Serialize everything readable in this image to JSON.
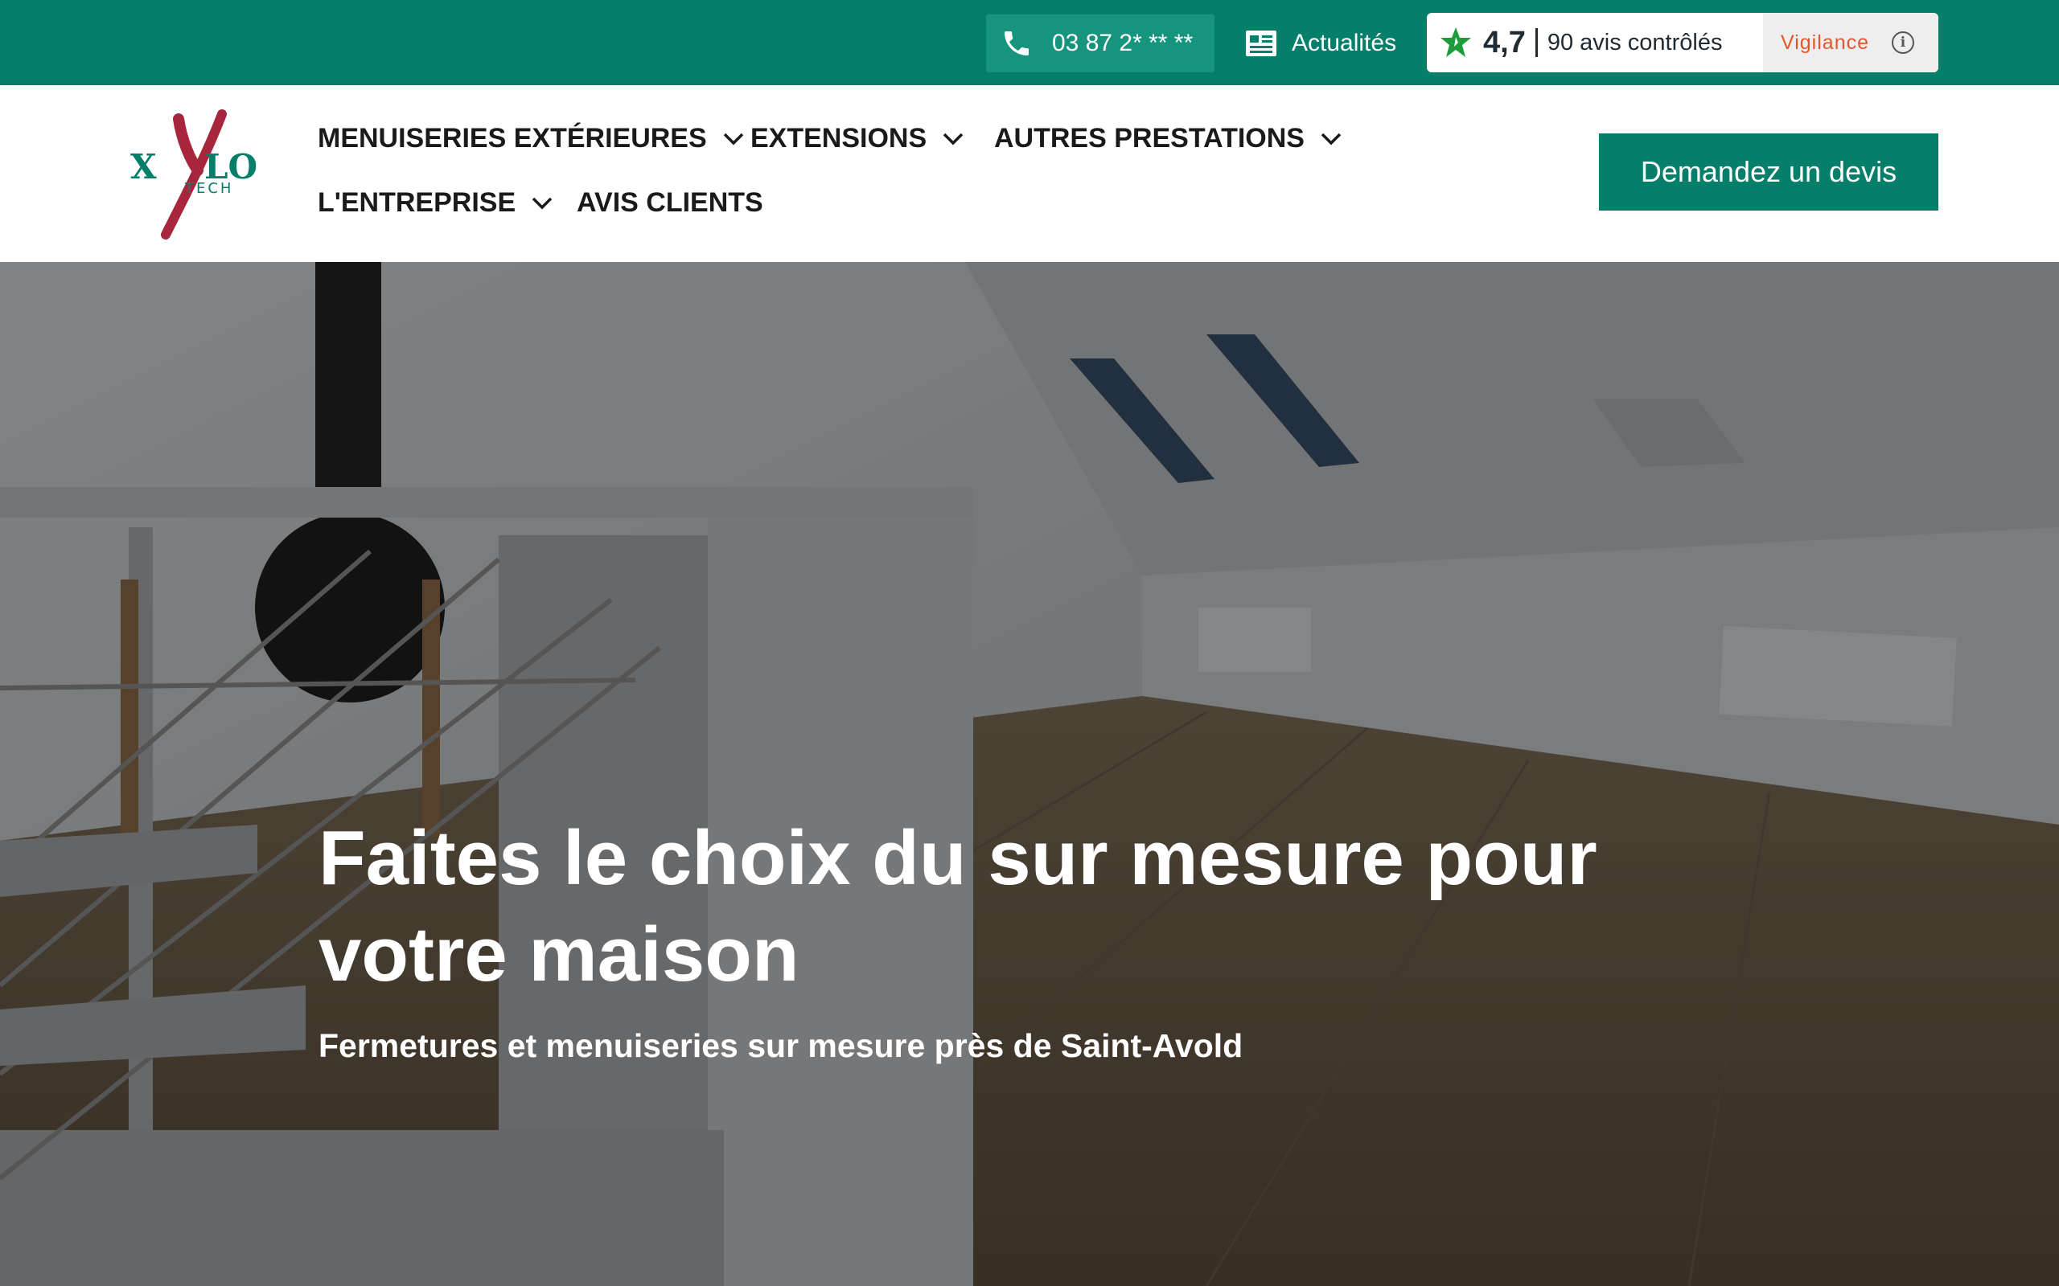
{
  "topbar": {
    "phone": "03 87 2* ** **",
    "news_label": "Actualités",
    "reviews": {
      "rating": "4,7",
      "count_label": "90 avis contrôlés",
      "vigilance_label": "Vigilance",
      "info_glyph": "i"
    }
  },
  "header": {
    "logo": {
      "text_x": "X",
      "text_lo": "LO",
      "text_tech": "TECH"
    },
    "nav": [
      {
        "label": "MENUISERIES EXTÉRIEURES",
        "has_dropdown": true
      },
      {
        "label": "EXTENSIONS",
        "has_dropdown": true
      },
      {
        "label": "AUTRES PRESTATIONS",
        "has_dropdown": true
      },
      {
        "label": "L'ENTREPRISE",
        "has_dropdown": true
      },
      {
        "label": "AVIS CLIENTS",
        "has_dropdown": false
      }
    ],
    "cta_label": "Demandez un devis"
  },
  "hero": {
    "title": "Faites le choix du sur mesure pour votre maison",
    "subtitle": "Fermetures et menuiseries sur mesure près de Saint-Avold"
  },
  "colors": {
    "brand_green": "#057e6a",
    "brand_green_light": "#16947e",
    "logo_red": "#a8263b",
    "vigilance_orange": "#e2572b"
  },
  "icons": [
    "phone-icon",
    "newspaper-icon",
    "star-icon",
    "info-icon",
    "chevron-down-icon"
  ]
}
